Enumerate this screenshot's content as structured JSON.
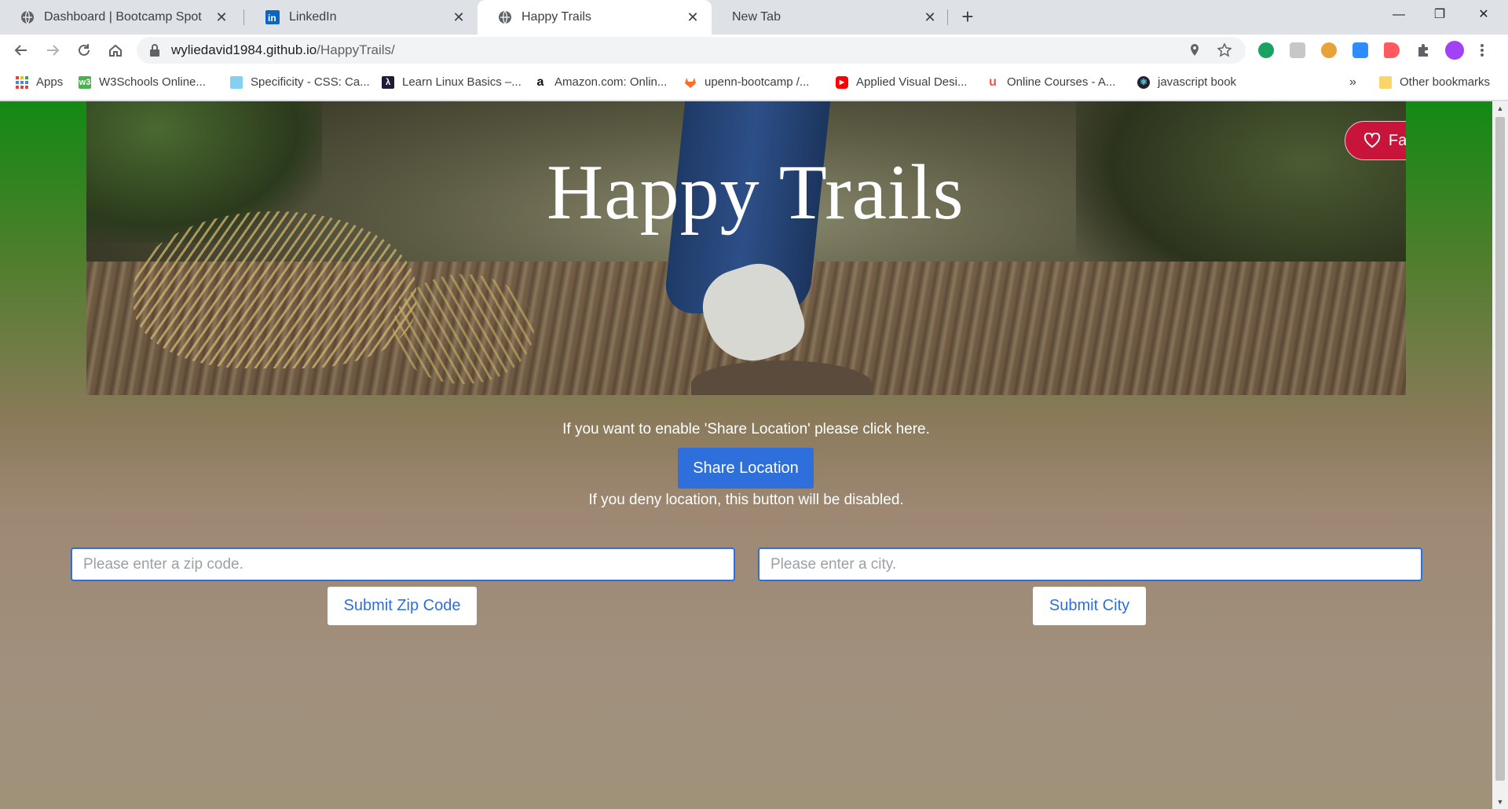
{
  "browser": {
    "tabs": [
      {
        "title": "Dashboard | Bootcamp Spot",
        "close": "✕"
      },
      {
        "title": "LinkedIn",
        "close": "✕"
      },
      {
        "title": "Happy Trails",
        "close": "✕"
      },
      {
        "title": "New Tab",
        "close": "✕"
      }
    ],
    "new_tab": "+",
    "window_controls": {
      "minimize": "—",
      "restore": "❐",
      "close": "✕"
    },
    "url_host": "wyliedavid1984.github.io",
    "url_path": "/HappyTrails/",
    "bookmarks": [
      {
        "label": "Apps",
        "icon": "apps-grid-icon"
      },
      {
        "label": "W3Schools Online...",
        "icon": "w3schools-icon"
      },
      {
        "label": "Specificity - CSS: Ca...",
        "icon": "mdn-icon"
      },
      {
        "label": "Learn Linux Basics –...",
        "icon": "linux-icon"
      },
      {
        "label": "Amazon.com: Onlin...",
        "icon": "amazon-icon"
      },
      {
        "label": "upenn-bootcamp /...",
        "icon": "gitlab-icon"
      },
      {
        "label": "Applied Visual Desi...",
        "icon": "youtube-icon"
      },
      {
        "label": "Online Courses - A...",
        "icon": "udemy-icon"
      },
      {
        "label": "javascript book",
        "icon": "react-icon"
      }
    ],
    "bookmarks_overflow": "»",
    "other_bookmarks": "Other bookmarks"
  },
  "page": {
    "hero_title": "Happy Trails",
    "favorites_label": "Favorites",
    "share_prompt": "If you want to enable 'Share Location' please click here.",
    "share_button": "Share Location",
    "deny_note": "If you deny location, this button will be disabled.",
    "zip_placeholder": "Please enter a zip code.",
    "city_placeholder": "Please enter a city.",
    "submit_zip": "Submit Zip Code",
    "submit_city": "Submit City"
  },
  "colors": {
    "share_button_bg": "#2f6fdb",
    "favorites_bg": "#c8143a",
    "link_blue": "#2f6fdb"
  }
}
